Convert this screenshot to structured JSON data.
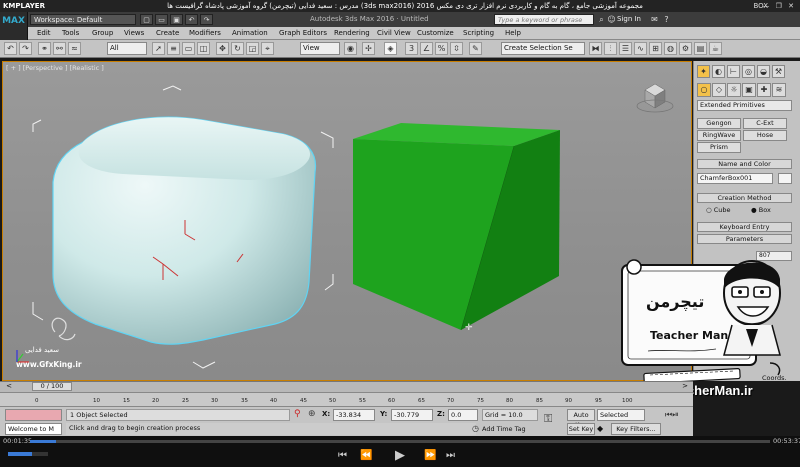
{
  "player": {
    "logo": "KMPLAYER",
    "title": "مجموعه آموزشی جامع ، گام به گام و کاربردی نرم افزار تری دی مکس 2016 (3ds max2016) مدرس : سعید فدایی (تیچرمن) گروه آموزشی پادشاه گرافیست ها",
    "box_label": "BOX",
    "window_controls": "— ❐ ✕",
    "time_elapsed": "00:01:35",
    "time_total": "00:53:37",
    "progress_fraction": 0.035,
    "controls": [
      "⏮",
      "⏪",
      "▶",
      "⏩",
      "⏭"
    ]
  },
  "max_title": {
    "logo": "MAX",
    "workspace": "Workspace: Default",
    "document": "Autodesk 3ds Max 2016 · Untitled",
    "search_placeholder": "Type a keyword or phrase",
    "sign_in": "Sign In"
  },
  "menu": [
    "Edit",
    "Tools",
    "Group",
    "Views",
    "Create",
    "Modifiers",
    "Animation",
    "Graph Editors",
    "Rendering",
    "Civil View",
    "Customize",
    "Scripting",
    "Help"
  ],
  "toolbar": {
    "selection_filter": "All",
    "ref_coord": "View",
    "named_selection": "Create Selection Se"
  },
  "viewport": {
    "label": "[ + ] [Perspective ] [Realistic ]",
    "watermark_name": "سعید فدایی",
    "watermark_site": "www.GfxKing.ir"
  },
  "command_panel": {
    "category": "Extended Primitives",
    "buttons": [
      "Gengon",
      "C-Ext",
      "RingWave",
      "Hose",
      "Prism"
    ],
    "name_color_title": "Name and Color",
    "object_name": "ChamferBox001",
    "creation_method_title": "Creation Method",
    "radio_cube": "Cube",
    "radio_box": "Box",
    "keyboard_entry_title": "Keyboard Entry",
    "parameters_title": "Parameters",
    "partial_value": "807",
    "coords_partial": "Coords."
  },
  "branding": {
    "url": "www.TeacherMan.ir",
    "name": "Teacher Man",
    "persian_name": "تیچرمن"
  },
  "timeline": {
    "frame_counter": "0 / 100",
    "ticks": [
      "0",
      "10",
      "15",
      "20",
      "25",
      "30",
      "35",
      "40",
      "45",
      "50",
      "55",
      "60",
      "65",
      "70",
      "75",
      "80",
      "85",
      "90",
      "95",
      "100"
    ]
  },
  "status": {
    "maxscript_text": "Welcome to M",
    "selection": "1 Object Selected",
    "prompt": "Click and drag to begin creation process",
    "x_label": "X:",
    "x_value": "-33.834",
    "y_label": "Y:",
    "y_value": "-30.779",
    "z_label": "Z:",
    "z_value": "0.0",
    "grid": "Grid = 10.0",
    "add_time_tag": "Add Time Tag",
    "auto_key": "Auto Key",
    "set_key": "Set Key",
    "selected_drop": "Selected",
    "key_filters": "Key Filters..."
  }
}
